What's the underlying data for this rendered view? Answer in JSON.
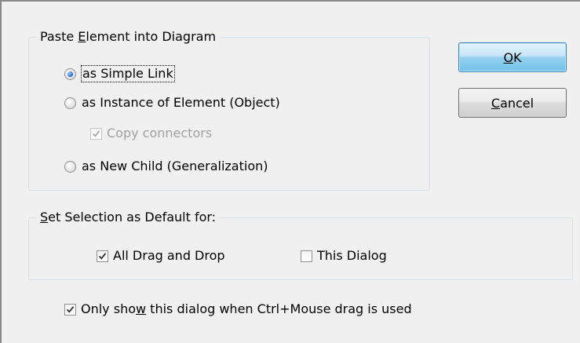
{
  "paste_group": {
    "title_pre": "Paste ",
    "title_accel": "E",
    "title_post": "lement into Diagram",
    "options": {
      "simple_link": "as Simple Link",
      "instance": "as Instance of Element (Object)",
      "copy_connectors": "Copy connectors",
      "new_child": "as New Child (Generalization)"
    },
    "selected": "simple_link",
    "copy_connectors_checked": true,
    "copy_connectors_enabled": false
  },
  "default_group": {
    "title_accel": "S",
    "title_post": "et Selection as Default for:",
    "all_drag_drop": "All Drag and Drop",
    "all_drag_drop_checked": true,
    "this_dialog": "This Dialog",
    "this_dialog_checked": false
  },
  "only_show": {
    "pre": "Only sho",
    "accel": "w",
    "post": " this dialog when Ctrl+Mouse drag is used",
    "checked": true
  },
  "buttons": {
    "ok_accel": "O",
    "ok_post": "K",
    "cancel_accel": "C",
    "cancel_post": "ancel"
  },
  "colors": {
    "dialog_bg": "#f0f0f0",
    "default_button": "#98d1ef",
    "radio_dot": "#2a6fd6"
  }
}
